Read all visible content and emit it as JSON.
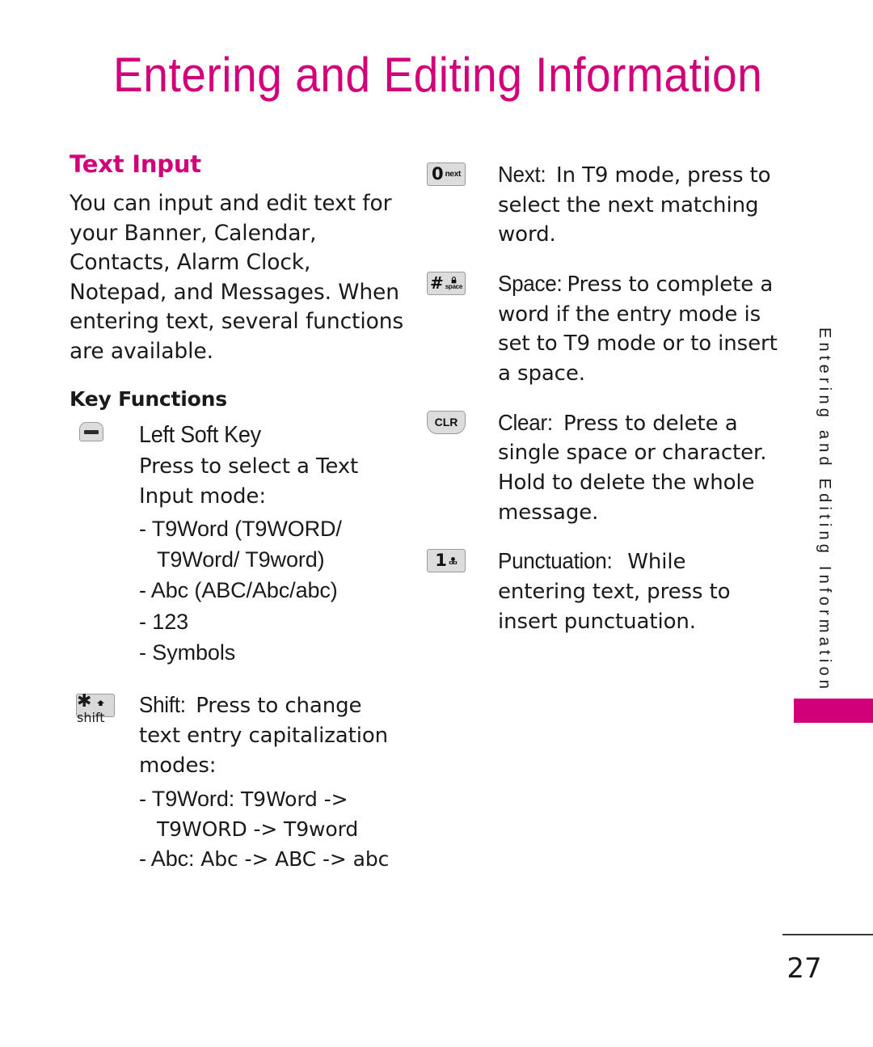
{
  "page": {
    "title": "Entering and Editing Information",
    "side_tab_text": "Entering and Editing Information",
    "page_number": "27",
    "accent_color": "#D1007A"
  },
  "left_column": {
    "heading": "Text Input",
    "intro": "You can input and edit text for your Banner, Calendar, Contacts, Alarm Clock, Notepad, and Messages. When entering text, several functions are available.",
    "key_functions_heading": "Key Functions",
    "entries": [
      {
        "icon": "left-soft-key-icon",
        "name": "Left Soft Key",
        "description": "Press to select a Text Input mode:",
        "modes": [
          "- T9Word (T9WORD/",
          "T9Word/ T9word)",
          "- Abc (ABC/Abc/abc)",
          "- 123",
          "- Symbols"
        ]
      },
      {
        "icon": "star-shift-key-icon",
        "name": "Shift:",
        "description": "Press to change text entry capitalization modes:",
        "modes": [
          "- T9Word:",
          " T9Word -> T9WORD -> T9word",
          "- Abc:",
          " Abc -> ABC -> abc"
        ],
        "mode_rows": [
          {
            "label": "- T9Word:",
            "value": " T9Word ->"
          },
          {
            "cont": "T9WORD -> T9word"
          },
          {
            "label": "- Abc:",
            "value": " Abc -> ABC -> abc"
          }
        ]
      }
    ]
  },
  "right_column": {
    "entries": [
      {
        "icon": "zero-next-key-icon",
        "key_glyph": "0",
        "key_sublabel": "next",
        "name": "Next:",
        "description": " In T9 mode, press to select the next matching word."
      },
      {
        "icon": "hash-space-key-icon",
        "key_glyph": "#",
        "key_sublabel": "space",
        "name": "Space:",
        "description": "Press to complete a word if the entry mode is set to T9 mode or to insert a space."
      },
      {
        "icon": "clear-key-icon",
        "key_glyph": "CLR",
        "name": "Clear:",
        "description": " Press to delete a single space or character. Hold to delete the whole message."
      },
      {
        "icon": "one-punctuation-key-icon",
        "key_glyph": "1",
        "name": "Punctuation:",
        "description": " While entering text, press to insert punctuation."
      }
    ]
  }
}
